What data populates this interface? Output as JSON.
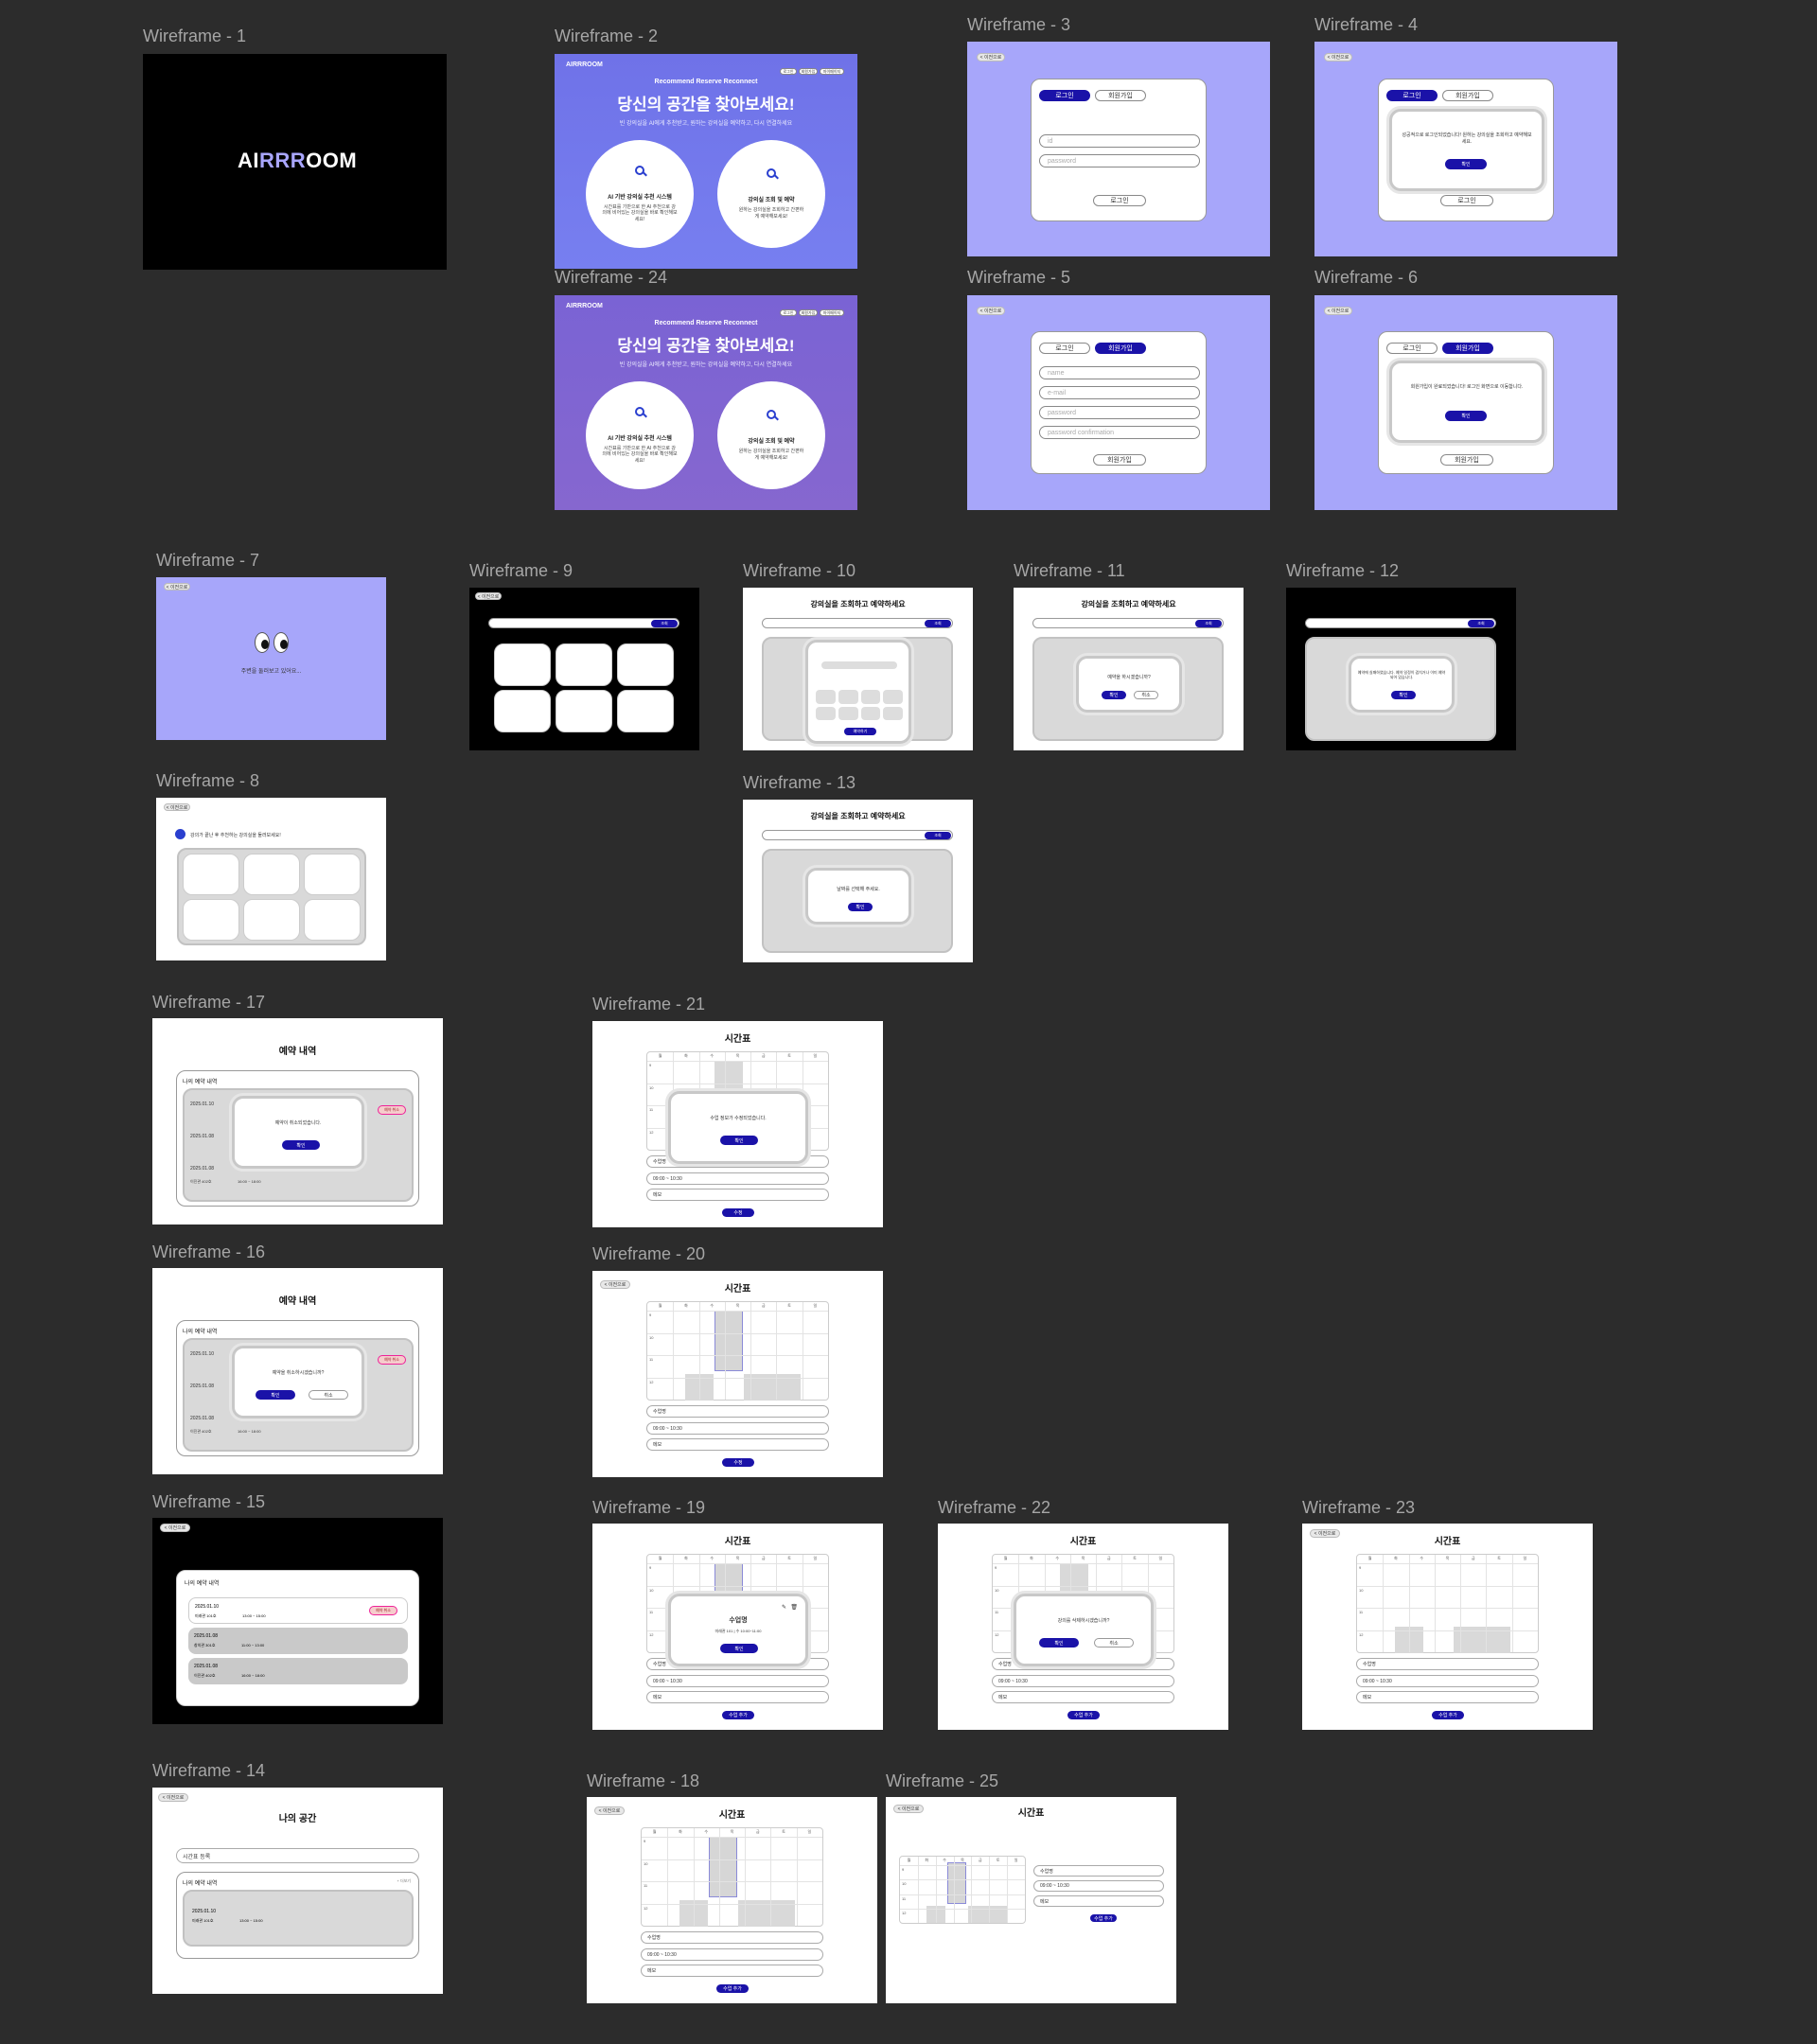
{
  "frames": {
    "wf1": "Wireframe - 1",
    "wf2": "Wireframe - 2",
    "wf3": "Wireframe - 3",
    "wf4": "Wireframe - 4",
    "wf24": "Wireframe - 24",
    "wf5": "Wireframe - 5",
    "wf6": "Wireframe - 6",
    "wf7": "Wireframe - 7",
    "wf9": "Wireframe - 9",
    "wf10": "Wireframe - 10",
    "wf11": "Wireframe - 11",
    "wf12": "Wireframe - 12",
    "wf8": "Wireframe - 8",
    "wf13": "Wireframe - 13",
    "wf17": "Wireframe - 17",
    "wf21": "Wireframe - 21",
    "wf16": "Wireframe - 16",
    "wf20": "Wireframe - 20",
    "wf15": "Wireframe - 15",
    "wf19": "Wireframe - 19",
    "wf22": "Wireframe - 22",
    "wf23": "Wireframe - 23",
    "wf14": "Wireframe - 14",
    "wf18": "Wireframe - 18",
    "wf25": "Wireframe - 25"
  },
  "brand": {
    "logo_a": "AI",
    "logo_b": "RRR",
    "logo_c": "OOM",
    "small_logo": "AIRRROOM"
  },
  "landing": {
    "tagline": "Recommend  Reserve  Reconnect",
    "headline": "당신의 공간을 찾아보세요!",
    "subtitle": "빈 강의실을 AI에게 추천받고, 원하는 강의실을 예약하고, 다시 연결하세요",
    "nav": [
      "로그인",
      "회원가입",
      "마이페이지"
    ],
    "card1_title": "AI 기반 강의실 추천 시스템",
    "card1_sub": "시간표를 기반으로 한 AI 추천으로 강의에 비어있는 강의실을 바로 확인해보세요!",
    "card2_title": "강의실 조회 및 예약",
    "card2_sub": "원하는 강의실을 조회하고 간편하게 예약해보세요!"
  },
  "auth": {
    "back": "< 이전으로",
    "login_tab": "로그인",
    "signup_tab": "회원가입",
    "id_ph": "id",
    "password_ph": "password",
    "name_ph": "name",
    "email_ph": "e-mail",
    "confirm_ph": "password confirmation",
    "login_btn": "로그인",
    "signup_btn": "회원가입",
    "login_ok_msg": "성공적으로 로그인되었습니다! 원하는 강의실을 조회하고 예약해보세요.",
    "signup_ok_msg": "회원가입이 완료되었습니다! 로그인 화면으로 이동합니다.",
    "confirm": "확인"
  },
  "loading": {
    "text": "주변을 둘러보고 있어요..."
  },
  "search": {
    "title": "강의실을 조회하고 예약하세요",
    "building": "건물 선택",
    "time": "시간 선택",
    "floor": "건물 층",
    "go": "조회",
    "reserve_q": "예약을 하시겠습니까?",
    "ok": "확인",
    "cancel": "취소",
    "fail_msg": "예약에 실패하였습니다. 예약 일정이 겹치거나 이미 예약되어 있습니다.",
    "select_msg": "날짜를 선택해 주세요.",
    "reserve_btn": "예약하기"
  },
  "recommend": {
    "text": "강의가 끝난 후 추천하는 강의실을 둘러보세요!"
  },
  "reservation": {
    "title": "예약 내역",
    "my_list": "나의 예약 내역",
    "cancel_msg": "예약이 취소되었습니다.",
    "cancel_q": "예약을 취소하시겠습니까?",
    "cancel_tag": "예약 취소",
    "items": [
      {
        "date": "2025.01.10",
        "place": "미래관 101호",
        "time": "13:00 ~ 15:00"
      },
      {
        "date": "2025.01.08",
        "place": "창의관 301호",
        "time": "11:00 ~ 13:00"
      },
      {
        "date": "2025.01.08",
        "place": "이진관 402호",
        "time": "16:00 ~ 18:00"
      }
    ]
  },
  "timetable": {
    "title": "시간표",
    "days": [
      "월",
      "화",
      "수",
      "목",
      "금",
      "토",
      "일"
    ],
    "hours": [
      "9",
      "10",
      "11",
      "12"
    ],
    "subject": "수업명",
    "weekday": "월요일",
    "time": "09:00 ~ 10:30",
    "memo": "메모",
    "save": "수정",
    "add": "수업 추가",
    "saved_msg": "수업 정보가 수정되었습니다.",
    "delete_q": "강의를 삭제하시겠습니까?",
    "class_name": "수업명",
    "class_detail": "미래관 101 | 수 10:00~11:00"
  },
  "myspace": {
    "title": "나의 공간",
    "timetable_btn": "시간표 등록",
    "more": "+ 더보기"
  }
}
